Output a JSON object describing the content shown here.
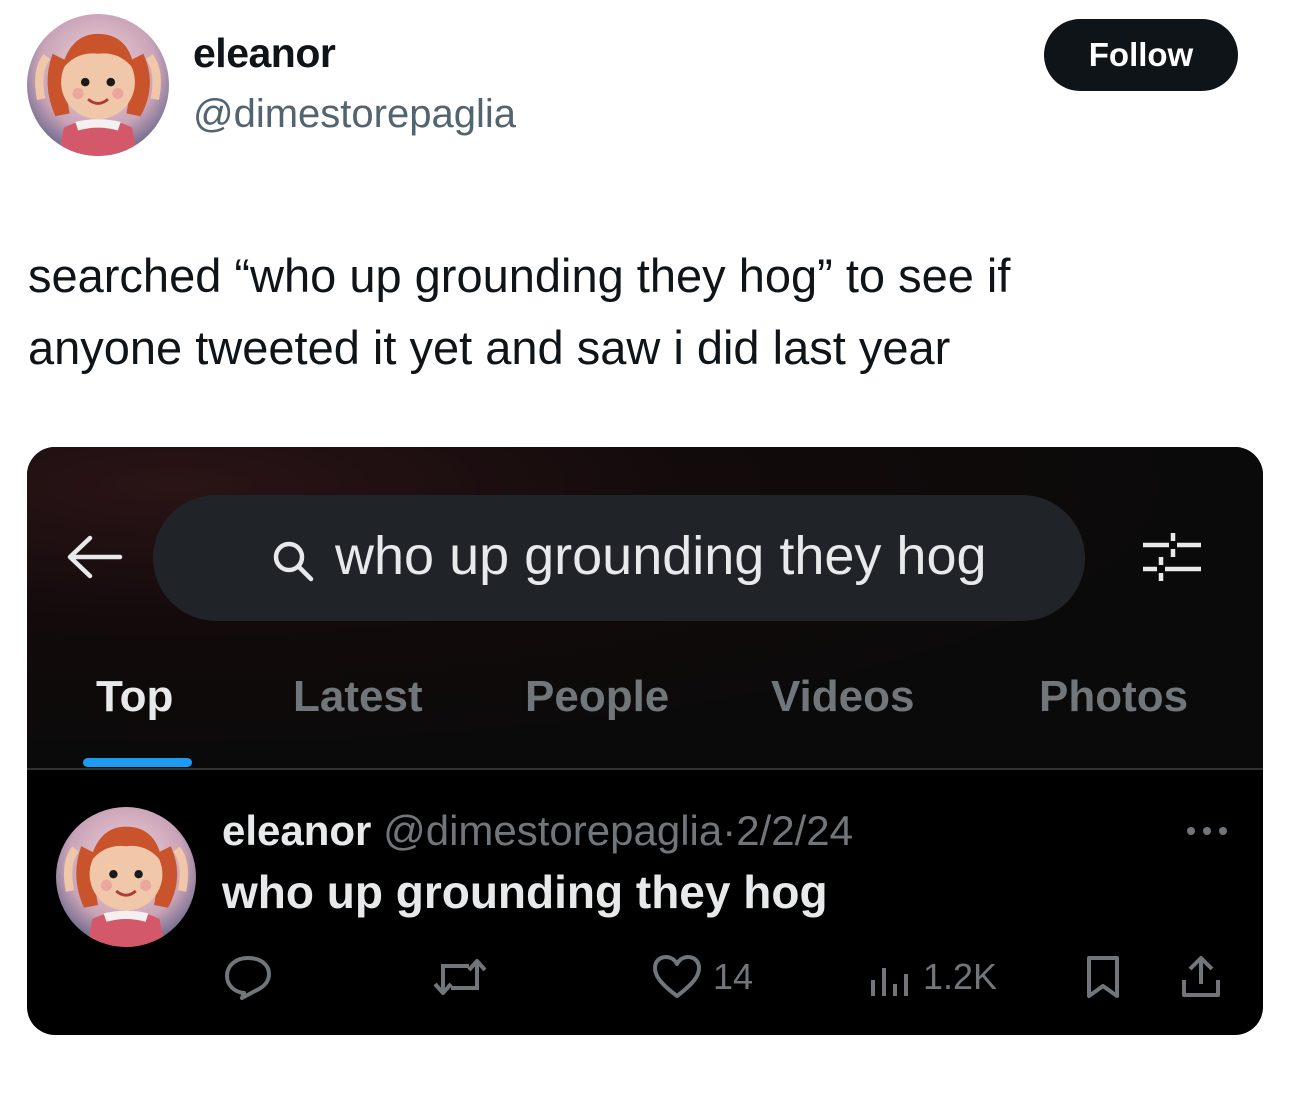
{
  "author": {
    "display_name": "eleanor",
    "handle": "@dimestorepaglia",
    "avatar_icon": "doll-avatar-icon"
  },
  "follow_button": {
    "label": "Follow"
  },
  "tweet": {
    "lines": [
      "searched “who up grounding they hog” to see if",
      "anyone tweeted it yet and saw i did last year"
    ]
  },
  "embedded_screenshot": {
    "search": {
      "query": "who up grounding they hog"
    },
    "tabs": [
      {
        "label": "Top",
        "active": true
      },
      {
        "label": "Latest",
        "active": false
      },
      {
        "label": "People",
        "active": false
      },
      {
        "label": "Videos",
        "active": false
      },
      {
        "label": "Photos",
        "active": false
      }
    ],
    "accent_color": "#1d9bf0",
    "result": {
      "display_name": "eleanor",
      "handle": "@dimestorepaglia",
      "separator": "·",
      "date": "2/2/24",
      "text": "who up grounding they hog",
      "likes": "14",
      "views": "1.2K"
    }
  }
}
